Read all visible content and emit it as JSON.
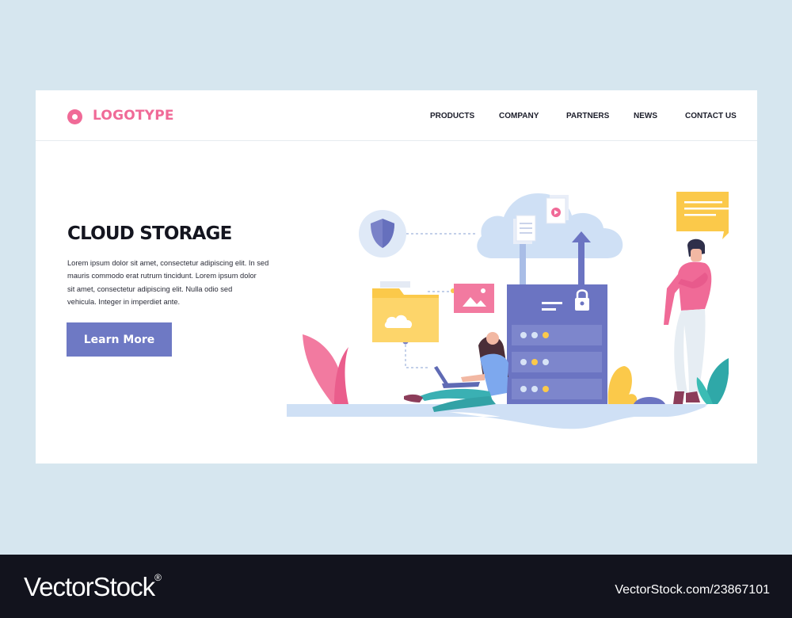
{
  "header": {
    "logo_text": "LOGOTYPE",
    "nav": [
      "PRODUCTS",
      "COMPANY",
      "PARTNERS",
      "NEWS",
      "CONTACT US"
    ]
  },
  "hero": {
    "title": "CLOUD STORAGE",
    "body_lines": [
      "Lorem ipsum dolor sit amet, consectetur adipiscing elit. In sed",
      "mauris commodo erat rutrum tincidunt. Lorem ipsum dolor",
      "sit amet, consectetur adipiscing elit. Nulla  odio sed",
      "vehicula. Integer in imperdiet ante."
    ],
    "cta_label": "Learn More"
  },
  "watermark": {
    "brand": "VectorStock",
    "registered": "®",
    "id_text": "VectorStock.com/23867101"
  },
  "colors": {
    "accent_pink": "#f06a97",
    "button_blue": "#6e79c4",
    "server_blue": "#6b74c2",
    "cloud": "#cfe0f5",
    "folder_yellow": "#fbc94a",
    "background": "#d6e6ef"
  }
}
